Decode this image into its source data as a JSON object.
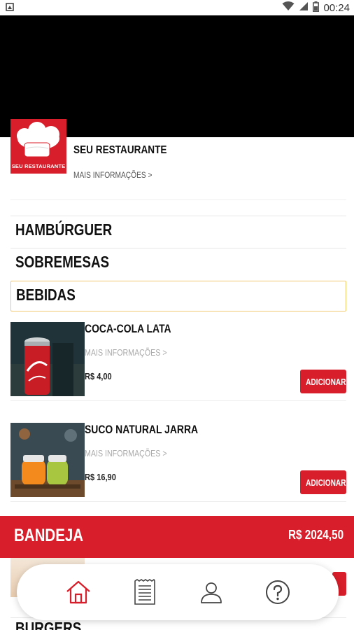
{
  "status_bar": {
    "time": "00:24"
  },
  "restaurant": {
    "logo_caption": "SEU RESTAURANTE",
    "name": "SEU RESTAURANTE",
    "more_info": "MAIS INFORMAÇÕES >"
  },
  "categories": [
    {
      "label": "HAMBÚRGUER"
    },
    {
      "label": "SOBREMESAS"
    },
    {
      "label": "BEBIDAS"
    }
  ],
  "products": [
    {
      "name": "COCA-COLA LATA",
      "more_info": "MAIS INFORMAÇÕES >",
      "price": "R$ 4,00",
      "add_label": "ADICIONAR"
    },
    {
      "name": "SUCO NATURAL JARRA",
      "more_info": "MAIS INFORMAÇÕES >",
      "price": "R$ 16,90",
      "add_label": "ADICIONAR"
    }
  ],
  "tray": {
    "label": "BANDEJA",
    "total": "R$ 2024,50"
  },
  "next_category": {
    "label": "BURGERS"
  },
  "colors": {
    "accent": "#d81e2a",
    "selected_border": "#f0c870"
  },
  "bottom_nav": [
    "home-icon",
    "receipt-icon",
    "user-icon",
    "help-icon"
  ]
}
